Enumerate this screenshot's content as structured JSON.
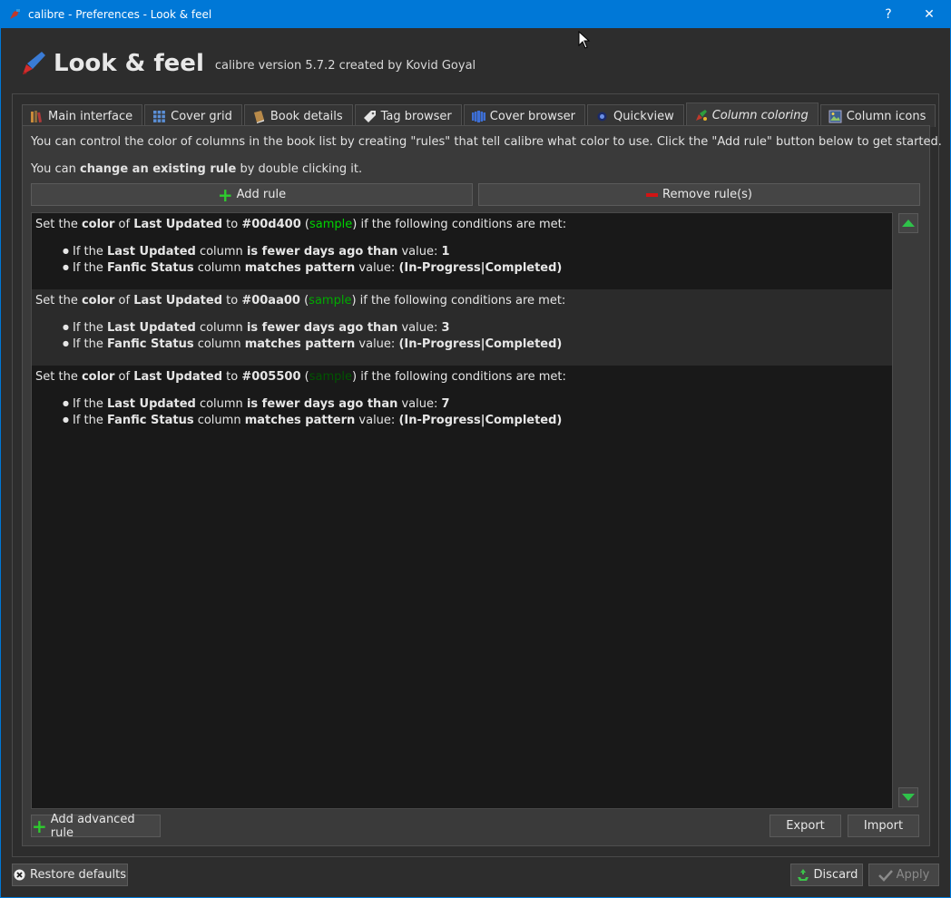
{
  "window": {
    "title": "calibre - Preferences - Look & feel",
    "help_glyph": "?",
    "close_glyph": "✕"
  },
  "header": {
    "title": "Look & feel",
    "subtitle": "calibre version 5.7.2 created by Kovid Goyal"
  },
  "tabs": [
    {
      "label": "Main interface",
      "icon": "books-icon",
      "active": false
    },
    {
      "label": "Cover grid",
      "icon": "grid-icon",
      "active": false
    },
    {
      "label": "Book details",
      "icon": "book-icon",
      "active": false
    },
    {
      "label": "Tag browser",
      "icon": "tag-icon",
      "active": false
    },
    {
      "label": "Cover browser",
      "icon": "cover-browser-icon",
      "active": false
    },
    {
      "label": "Quickview",
      "icon": "eye-icon",
      "active": false
    },
    {
      "label": "Column coloring",
      "icon": "palette-icon",
      "active": true
    },
    {
      "label": "Column icons",
      "icon": "image-icon",
      "active": false
    }
  ],
  "intro": {
    "line1": "You can control the color of columns in the book list by creating \"rules\" that tell calibre what color to use. Click the \"Add rule\" button below to get started.",
    "line2_prefix": "You can ",
    "line2_bold": "change an existing rule",
    "line2_suffix": " by double clicking it."
  },
  "buttons": {
    "add_rule": "Add rule",
    "remove_rules": "Remove rule(s)",
    "add_advanced_rule": "Add advanced rule",
    "export": "Export",
    "import": "Import",
    "restore_defaults": "Restore defaults",
    "discard": "Discard",
    "apply": "Apply"
  },
  "rule_text": {
    "set_the": "Set the ",
    "color": "color",
    "of": " of ",
    "to": " to ",
    "open_paren": " (",
    "sample": "sample",
    "close_suffix": ") if the following conditions are met:",
    "if_the": "If the ",
    "column": " column ",
    "value": " value: "
  },
  "rules": [
    {
      "column": "Last Updated",
      "color": "#00d400",
      "conditions": [
        {
          "column": "Last Updated",
          "op": "is fewer days ago than",
          "value": "1"
        },
        {
          "column": "Fanfic Status",
          "op": "matches pattern",
          "value": "(In-Progress|Completed)"
        }
      ]
    },
    {
      "column": "Last Updated",
      "color": "#00aa00",
      "conditions": [
        {
          "column": "Last Updated",
          "op": "is fewer days ago than",
          "value": "3"
        },
        {
          "column": "Fanfic Status",
          "op": "matches pattern",
          "value": "(In-Progress|Completed)"
        }
      ]
    },
    {
      "column": "Last Updated",
      "color": "#005500",
      "conditions": [
        {
          "column": "Last Updated",
          "op": "is fewer days ago than",
          "value": "7"
        },
        {
          "column": "Fanfic Status",
          "op": "matches pattern",
          "value": "(In-Progress|Completed)"
        }
      ]
    }
  ],
  "colors": {
    "titlebar": "#0078d7",
    "background": "#2d2d2d",
    "list_bg": "#191919",
    "add_green": "#2ecc2e",
    "remove_red": "#d21414"
  }
}
